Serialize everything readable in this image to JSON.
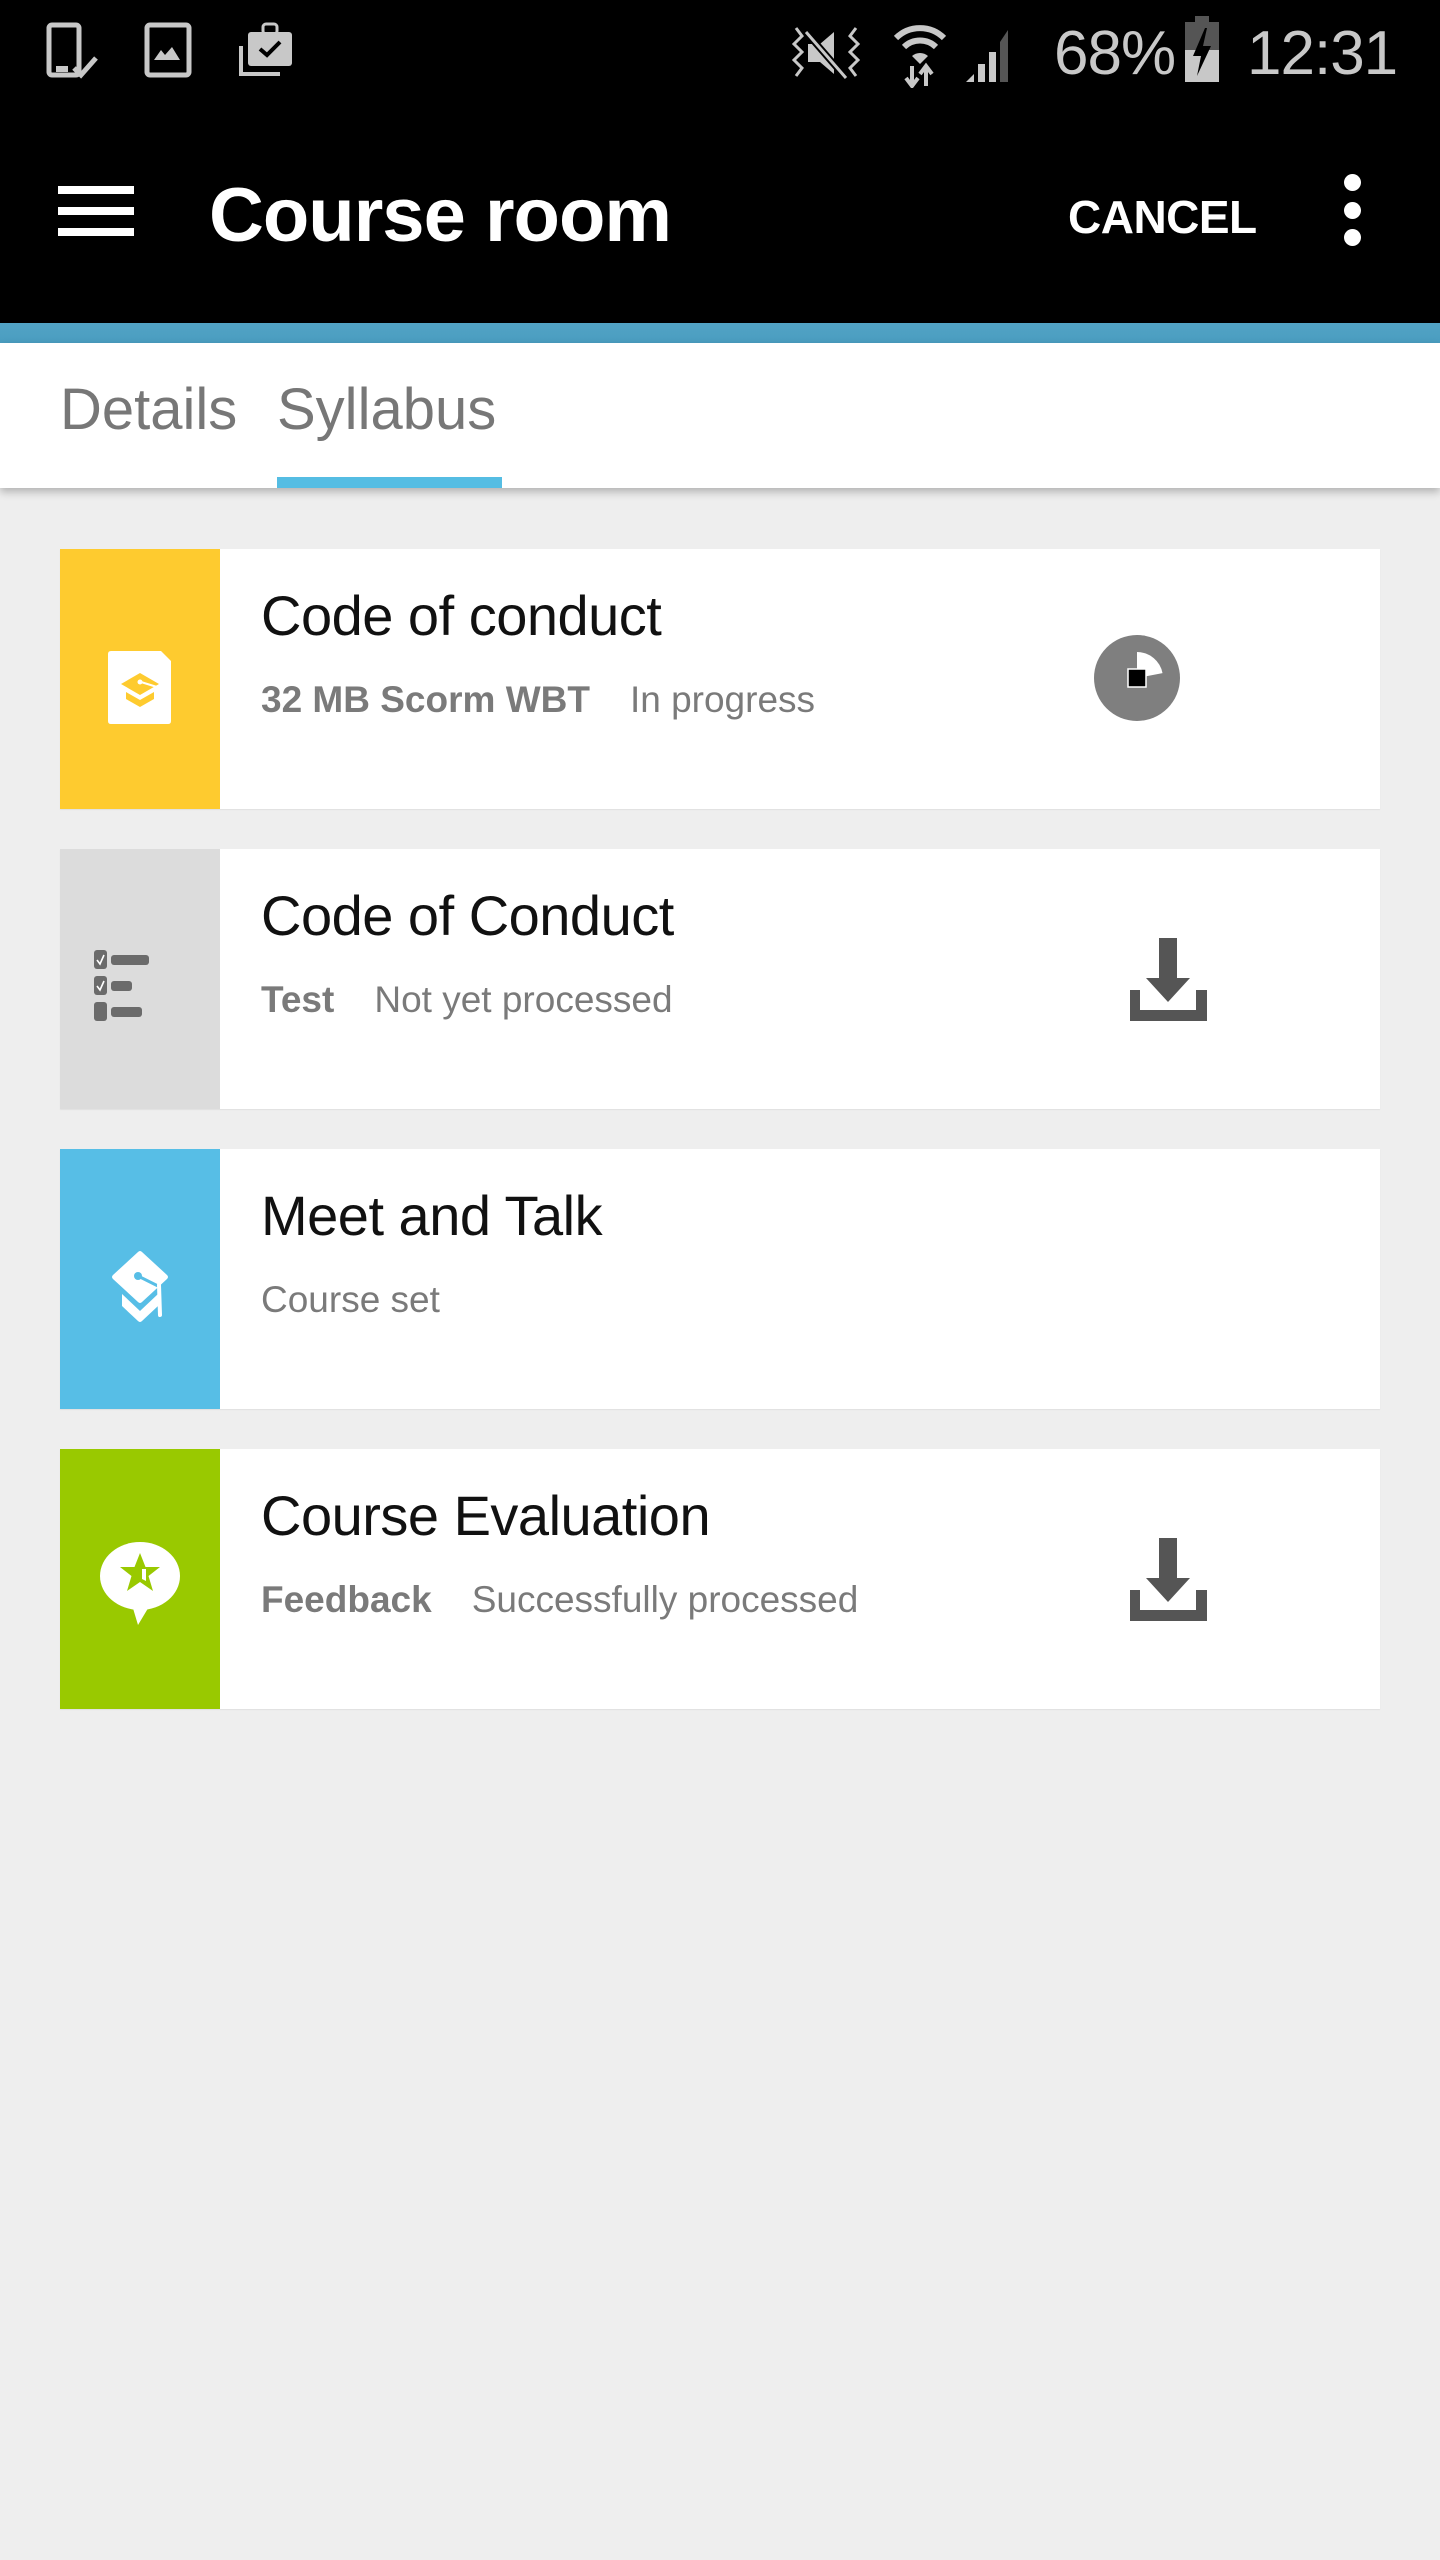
{
  "status_bar": {
    "left_icons": [
      "device-check-icon",
      "gallery-icon",
      "briefcase-check-icon"
    ],
    "right_icons": [
      "vibrate-mute-icon",
      "wifi-data-icon",
      "signal-icon"
    ],
    "battery_percent": "68%",
    "battery_charging": true,
    "time": "12:31"
  },
  "app_bar": {
    "menu_icon": "hamburger-menu-icon",
    "title": "Course room",
    "cancel_label": "CANCEL",
    "overflow_icon": "more-vertical-icon"
  },
  "colors": {
    "accent": "#55bde3",
    "accent_strip": "#4fa0c3",
    "background": "#eeeeee"
  },
  "tabs": [
    {
      "label": "Details",
      "active": false
    },
    {
      "label": "Syllabus",
      "active": true
    }
  ],
  "syllabus": [
    {
      "title": "Code of conduct",
      "type": "32 MB Scorm WBT",
      "status": "In progress",
      "icon": "scorm-document-icon",
      "tile_color": "#fecb2f",
      "action": "download-progress-stop-icon",
      "progress": 0.22
    },
    {
      "title": "Code of Conduct",
      "type": "Test",
      "status": "Not yet processed",
      "icon": "checklist-icon",
      "tile_color": "#dcdcdc",
      "action": "download-icon"
    },
    {
      "title": "Meet and Talk",
      "type": "",
      "status": "Course set",
      "icon": "mortarboard-icon",
      "tile_color": "#57bee6",
      "action": ""
    },
    {
      "title": "Course Evaluation",
      "type": "Feedback",
      "status": "Successfully processed",
      "icon": "feedback-star-icon",
      "tile_color": "#99c900",
      "action": "download-icon"
    }
  ]
}
